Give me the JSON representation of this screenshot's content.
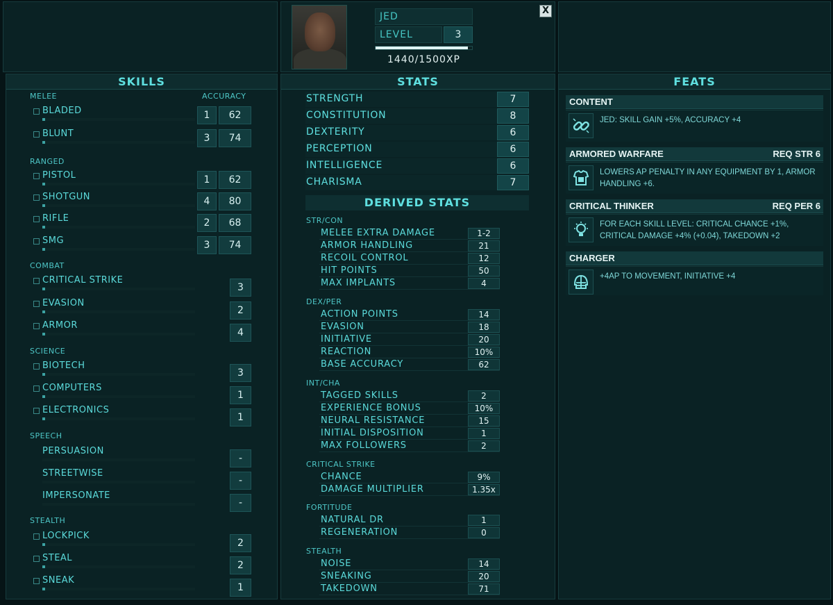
{
  "character": {
    "name": "JED",
    "level_label": "LEVEL",
    "level": "3",
    "xp_text": "1440/1500XP",
    "xp_fraction": 0.96,
    "close_label": "X"
  },
  "skills": {
    "header": "SKILLS",
    "accuracy_header": "ACCURACY",
    "categories": [
      {
        "name": "MELEE",
        "items": [
          {
            "name": "BLADED",
            "rank": "1",
            "accuracy": "62",
            "tagged": true
          },
          {
            "name": "BLUNT",
            "rank": "3",
            "accuracy": "74",
            "tagged": true
          }
        ]
      },
      {
        "name": "RANGED",
        "items": [
          {
            "name": "PISTOL",
            "rank": "1",
            "accuracy": "62",
            "tagged": true
          },
          {
            "name": "SHOTGUN",
            "rank": "4",
            "accuracy": "80",
            "tagged": true
          },
          {
            "name": "RIFLE",
            "rank": "2",
            "accuracy": "68",
            "tagged": true
          },
          {
            "name": "SMG",
            "rank": "3",
            "accuracy": "74",
            "tagged": true
          }
        ]
      },
      {
        "name": "COMBAT",
        "items": [
          {
            "name": "CRITICAL STRIKE",
            "rank": "3",
            "tagged": true
          },
          {
            "name": "EVASION",
            "rank": "2",
            "tagged": true
          },
          {
            "name": "ARMOR",
            "rank": "4",
            "tagged": true
          }
        ]
      },
      {
        "name": "SCIENCE",
        "items": [
          {
            "name": "BIOTECH",
            "rank": "3",
            "tagged": true
          },
          {
            "name": "COMPUTERS",
            "rank": "1",
            "tagged": true
          },
          {
            "name": "ELECTRONICS",
            "rank": "1",
            "tagged": true
          }
        ]
      },
      {
        "name": "SPEECH",
        "items": [
          {
            "name": "PERSUASION",
            "rank": "-",
            "tagged": false
          },
          {
            "name": "STREETWISE",
            "rank": "-",
            "tagged": false
          },
          {
            "name": "IMPERSONATE",
            "rank": "-",
            "tagged": false
          }
        ]
      },
      {
        "name": "STEALTH",
        "items": [
          {
            "name": "LOCKPICK",
            "rank": "2",
            "tagged": true
          },
          {
            "name": "STEAL",
            "rank": "2",
            "tagged": true
          },
          {
            "name": "SNEAK",
            "rank": "1",
            "tagged": true
          }
        ]
      }
    ]
  },
  "stats": {
    "header": "STATS",
    "attributes": [
      {
        "name": "STRENGTH",
        "value": "7"
      },
      {
        "name": "CONSTITUTION",
        "value": "8"
      },
      {
        "name": "DEXTERITY",
        "value": "6"
      },
      {
        "name": "PERCEPTION",
        "value": "6"
      },
      {
        "name": "INTELLIGENCE",
        "value": "6"
      },
      {
        "name": "CHARISMA",
        "value": "7"
      }
    ],
    "derived_header": "DERIVED STATS",
    "derived_groups": [
      {
        "name": "STR/CON",
        "items": [
          {
            "name": "MELEE EXTRA DAMAGE",
            "value": "1-2"
          },
          {
            "name": "ARMOR HANDLING",
            "value": "21"
          },
          {
            "name": "RECOIL CONTROL",
            "value": "12"
          },
          {
            "name": "HIT POINTS",
            "value": "50"
          },
          {
            "name": "MAX IMPLANTS",
            "value": "4"
          }
        ]
      },
      {
        "name": "DEX/PER",
        "items": [
          {
            "name": "ACTION POINTS",
            "value": "14"
          },
          {
            "name": "EVASION",
            "value": "18"
          },
          {
            "name": "INITIATIVE",
            "value": "20"
          },
          {
            "name": "REACTION",
            "value": "10%"
          },
          {
            "name": "BASE ACCURACY",
            "value": "62"
          }
        ]
      },
      {
        "name": "INT/CHA",
        "items": [
          {
            "name": "TAGGED SKILLS",
            "value": "2"
          },
          {
            "name": "EXPERIENCE BONUS",
            "value": "10%"
          },
          {
            "name": "NEURAL RESISTANCE",
            "value": "15"
          },
          {
            "name": "INITIAL DISPOSITION",
            "value": "1"
          },
          {
            "name": "MAX FOLLOWERS",
            "value": "2"
          }
        ]
      },
      {
        "name": "CRITICAL STRIKE",
        "items": [
          {
            "name": "CHANCE",
            "value": "9%"
          },
          {
            "name": "DAMAGE MULTIPLIER",
            "value": "1.35x"
          }
        ]
      },
      {
        "name": "FORTITUDE",
        "items": [
          {
            "name": "NATURAL DR",
            "value": "1"
          },
          {
            "name": "REGENERATION",
            "value": "0"
          }
        ]
      },
      {
        "name": "STEALTH",
        "items": [
          {
            "name": "NOISE",
            "value": "14"
          },
          {
            "name": "SNEAKING",
            "value": "20"
          },
          {
            "name": "TAKEDOWN",
            "value": "71"
          }
        ]
      }
    ]
  },
  "feats": {
    "header": "FEATS",
    "items": [
      {
        "name": "CONTENT",
        "req": "",
        "icon": "chain-link-icon",
        "desc": "JED: SKILL GAIN +5%, ACCURACY +4"
      },
      {
        "name": "ARMORED WARFARE",
        "req": "REQ STR 6",
        "icon": "armor-vest-icon",
        "desc": "LOWERS AP PENALTY IN ANY EQUIPMENT BY 1, ARMOR HANDLING +6."
      },
      {
        "name": "CRITICAL THINKER",
        "req": "REQ PER 6",
        "icon": "lightbulb-icon",
        "desc": "FOR EACH SKILL LEVEL: CRITICAL CHANCE +1%, CRITICAL DAMAGE +4% (+0.04), TAKEDOWN +2"
      },
      {
        "name": "CHARGER",
        "req": "",
        "icon": "football-helmet-icon",
        "desc": "+4AP TO MOVEMENT, INITIATIVE +4"
      }
    ]
  },
  "colors": {
    "background": "#061416",
    "accent": "#5fe0e0",
    "value_text": "#e2f3f3"
  }
}
